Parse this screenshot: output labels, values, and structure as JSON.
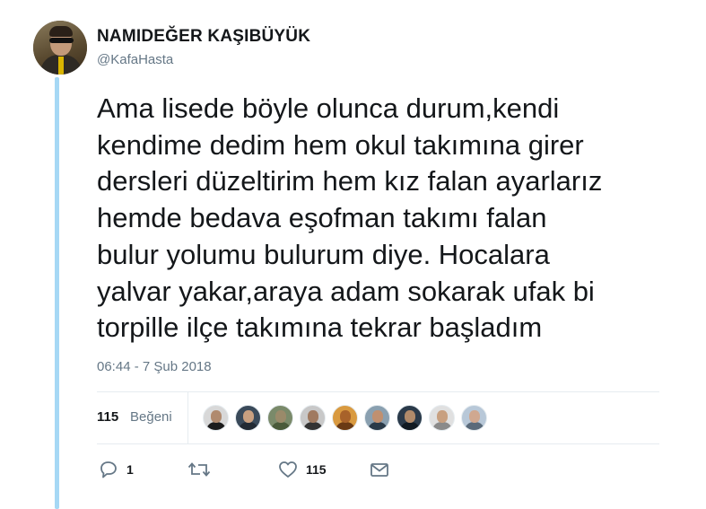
{
  "tweet": {
    "display_name": "NAMIDEĞER KAŞIBÜYÜK",
    "username": "@KafaHasta",
    "text": "Ama lisede böyle olunca durum,kendi\nkendime dedim hem okul takımına girer\ndersleri düzeltirim hem kız falan ayarlarız\nhemde bedava eşofman takımı falan\nbulur yolumu bulurum diye. Hocalara\nyalvar yakar,araya adam sokarak ufak bi\ntorpille ilçe takımına tekrar başladım",
    "timestamp": "06:44 - 7 Şub 2018"
  },
  "stats": {
    "likes_count": "115",
    "likes_label": "Beğeni",
    "likers": [
      {
        "icon": "liker-avatar-1",
        "bg": "#d8d8d8",
        "face": "#b08a6e",
        "body": "#1c1c1c"
      },
      {
        "icon": "liker-avatar-2",
        "bg": "#3a4a5a",
        "face": "#c9a080",
        "body": "#222a33"
      },
      {
        "icon": "liker-avatar-3",
        "bg": "#7a8a6a",
        "face": "#9a8a6a",
        "body": "#4a5a3a"
      },
      {
        "icon": "liker-avatar-4",
        "bg": "#c8c8c8",
        "face": "#a07a60",
        "body": "#333333"
      },
      {
        "icon": "liker-avatar-5",
        "bg": "#d99a40",
        "face": "#a8622a",
        "body": "#6a3a14"
      },
      {
        "icon": "liker-avatar-6",
        "bg": "#8aa0b0",
        "face": "#c09070",
        "body": "#2a3a48"
      },
      {
        "icon": "liker-avatar-7",
        "bg": "#2a3a4a",
        "face": "#b08a6a",
        "body": "#111a22"
      },
      {
        "icon": "liker-avatar-8",
        "bg": "#e0e0e0",
        "face": "#c8a080",
        "body": "#8a8a8a"
      },
      {
        "icon": "liker-avatar-9",
        "bg": "#b8c8d8",
        "face": "#d0a890",
        "body": "#5a6a7a"
      }
    ]
  },
  "actions": {
    "reply_count": "1",
    "retweet_count": "",
    "like_count": "115"
  },
  "colors": {
    "thread_line": "#a6d8f5",
    "secondary_text": "#657786",
    "icon_gray": "#657786"
  }
}
